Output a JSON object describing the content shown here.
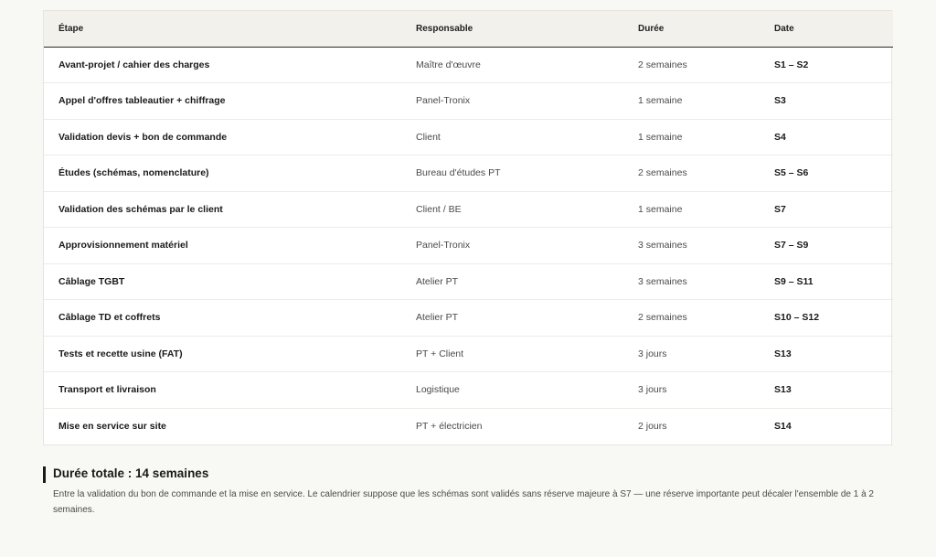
{
  "table": {
    "headers": [
      "Étape",
      "Responsable",
      "Durée",
      "Date"
    ],
    "rows": [
      {
        "step": "Avant-projet / cahier des charges",
        "responsible": "Maître d'œuvre",
        "duration": "2 semaines",
        "date": "S1 – S2"
      },
      {
        "step": "Appel d'offres tableautier + chiffrage",
        "responsible": "Panel-Tronix",
        "duration": "1 semaine",
        "date": "S3"
      },
      {
        "step": "Validation devis + bon de commande",
        "responsible": "Client",
        "duration": "1 semaine",
        "date": "S4"
      },
      {
        "step": "Études (schémas, nomenclature)",
        "responsible": "Bureau d'études PT",
        "duration": "2 semaines",
        "date": "S5 – S6"
      },
      {
        "step": "Validation des schémas par le client",
        "responsible": "Client / BE",
        "duration": "1 semaine",
        "date": "S7"
      },
      {
        "step": "Approvisionnement matériel",
        "responsible": "Panel-Tronix",
        "duration": "3 semaines",
        "date": "S7 – S9"
      },
      {
        "step": "Câblage TGBT",
        "responsible": "Atelier PT",
        "duration": "3 semaines",
        "date": "S9 – S11"
      },
      {
        "step": "Câblage TD et coffrets",
        "responsible": "Atelier PT",
        "duration": "2 semaines",
        "date": "S10 – S12"
      },
      {
        "step": "Tests et recette usine (FAT)",
        "responsible": "PT + Client",
        "duration": "3 jours",
        "date": "S13"
      },
      {
        "step": "Transport et livraison",
        "responsible": "Logistique",
        "duration": "3 jours",
        "date": "S13"
      },
      {
        "step": "Mise en service sur site",
        "responsible": "PT + électricien",
        "duration": "2 jours",
        "date": "S14"
      }
    ]
  },
  "summary": {
    "title": "Durée totale : 14 semaines",
    "text": "Entre la validation du bon de commande et la mise en service. Le calendrier suppose que les schémas sont validés sans réserve majeure à S7 — une réserve importante peut décaler l'ensemble de 1 à 2 semaines."
  },
  "colors": {
    "background": "#f8f8f4",
    "header_background": "#f3f1eb",
    "accent_bar": "#1a1a1a"
  }
}
